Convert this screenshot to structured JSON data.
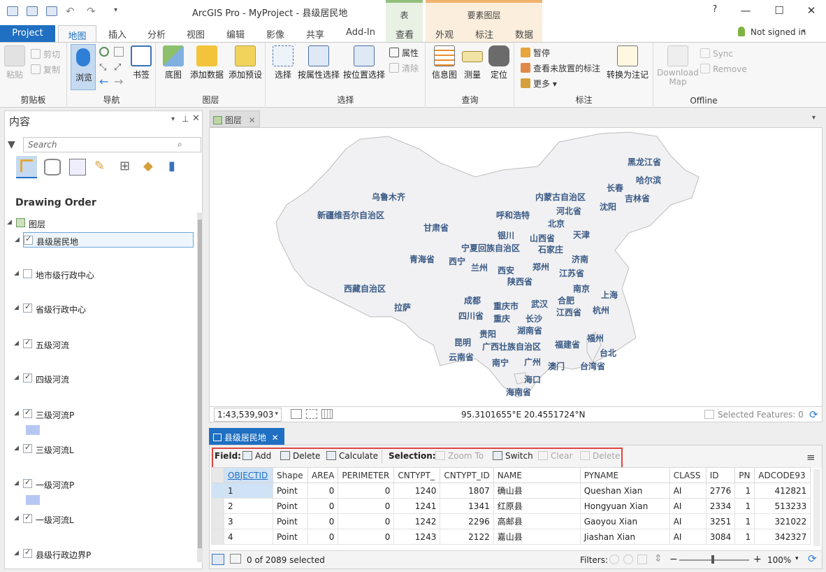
{
  "window": {
    "title": "ArcGIS Pro - MyProject - 县级居民地"
  },
  "context_groups": {
    "table": "表",
    "feature_layer": "要素图层"
  },
  "tabs": {
    "project": "Project",
    "map": "地图",
    "insert": "插入",
    "analysis": "分析",
    "view": "视图",
    "edit": "编辑",
    "imagery": "影像",
    "share": "共享",
    "addin": "Add-In",
    "view2": "查看",
    "appearance": "外观",
    "labeling": "标注",
    "data": "数据"
  },
  "help_label": "?",
  "user": {
    "label": "Not signed in"
  },
  "ribbon": {
    "clipboard": {
      "label": "剪贴板",
      "paste": "粘贴",
      "cut": "剪切",
      "copy": "复制"
    },
    "navigate": {
      "label": "导航",
      "explore": "浏览",
      "bookmarks": "书签"
    },
    "layer": {
      "label": "图层",
      "basemap": "底图",
      "add_data": "添加数据",
      "add_preset": "添加预设"
    },
    "selection": {
      "label": "选择",
      "select": "选择",
      "select_by_attr": "按属性选择",
      "select_by_loc": "按位置选择",
      "attributes": "属性",
      "clear": "清除"
    },
    "inquiry": {
      "label": "查询",
      "infographics": "信息图",
      "measure": "测量",
      "locate": "定位"
    },
    "labeling": {
      "label": "标注",
      "pause": "暂停",
      "view_unplaced": "查看未放置的标注",
      "more": "更多",
      "convert": "转换为注记"
    },
    "offline": {
      "label": "Offline",
      "download": "Download Map",
      "sync": "Sync",
      "remove": "Remove"
    }
  },
  "contents": {
    "title": "内容",
    "search_placeholder": "Search",
    "drawing_order": "Drawing Order",
    "map_name": "图层",
    "layers": [
      {
        "name": "县级居民地",
        "checked": true
      },
      {
        "name": "地市级行政中心",
        "checked": false
      },
      {
        "name": "省级行政中心",
        "checked": true
      },
      {
        "name": "五级河流",
        "checked": true
      },
      {
        "name": "四级河流",
        "checked": true
      },
      {
        "name": "三级河流P",
        "checked": true
      },
      {
        "name": "三级河流L",
        "checked": true
      },
      {
        "name": "一级河流P",
        "checked": true
      },
      {
        "name": "一级河流L",
        "checked": true
      },
      {
        "name": "县级行政边界P",
        "checked": true
      }
    ]
  },
  "map_view": {
    "tab": "图层",
    "scale": "1:43,539,903",
    "coordinates": "95.3101655°E 20.4551724°N",
    "selected_features": "Selected Features: 0",
    "places": [
      "黑龙江省",
      "哈尔滨",
      "长春",
      "吉林省",
      "沈阳",
      "内蒙古自治区",
      "乌鲁木齐",
      "新疆维吾尔自治区",
      "呼和浩特",
      "河北省",
      "北京",
      "天津",
      "甘肃省",
      "银川",
      "山西省",
      "宁夏回族自治区",
      "石家庄",
      "济南",
      "青海省",
      "西宁",
      "兰州",
      "西安",
      "郑州",
      "江苏省",
      "陕西省",
      "西藏自治区",
      "南京",
      "上海",
      "成都",
      "武汉",
      "合肥",
      "杭州",
      "拉萨",
      "重庆市",
      "四川省",
      "重庆",
      "长沙",
      "江西省",
      "湖南省",
      "贵阳",
      "昆明",
      "广西壮族自治区",
      "福建省",
      "福州",
      "台北",
      "云南省",
      "南宁",
      "广州",
      "澳门",
      "台湾省",
      "海口",
      "海南省"
    ]
  },
  "attribute_table": {
    "tab": "县级居民地",
    "toolbar": {
      "field": "Field:",
      "add": "Add",
      "delete": "Delete",
      "calculate": "Calculate",
      "selection": "Selection:",
      "zoom_to": "Zoom To",
      "switch": "Switch",
      "clear": "Clear",
      "delete2": "Delete"
    },
    "columns": [
      "OBJECTID",
      "Shape",
      "AREA",
      "PERIMETER",
      "CNTYPT_",
      "CNTYPT_ID",
      "NAME",
      "PYNAME",
      "CLASS",
      "ID",
      "PN",
      "ADCODE93"
    ],
    "rows": [
      [
        "1",
        "Point",
        "0",
        "0",
        "1240",
        "1807",
        "确山县",
        "Queshan Xian",
        "AI",
        "2776",
        "1",
        "412821"
      ],
      [
        "2",
        "Point",
        "0",
        "0",
        "1241",
        "1341",
        "红原县",
        "Hongyuan Xian",
        "AI",
        "2334",
        "1",
        "513233"
      ],
      [
        "3",
        "Point",
        "0",
        "0",
        "1242",
        "2296",
        "高邮县",
        "Gaoyou Xian",
        "AI",
        "3251",
        "1",
        "321022"
      ],
      [
        "4",
        "Point",
        "0",
        "0",
        "1243",
        "2122",
        "嘉山县",
        "Jiashan Xian",
        "AI",
        "3084",
        "1",
        "342327"
      ]
    ],
    "status": "0 of 2089 selected",
    "filters": "Filters:",
    "zoom": "100%"
  }
}
